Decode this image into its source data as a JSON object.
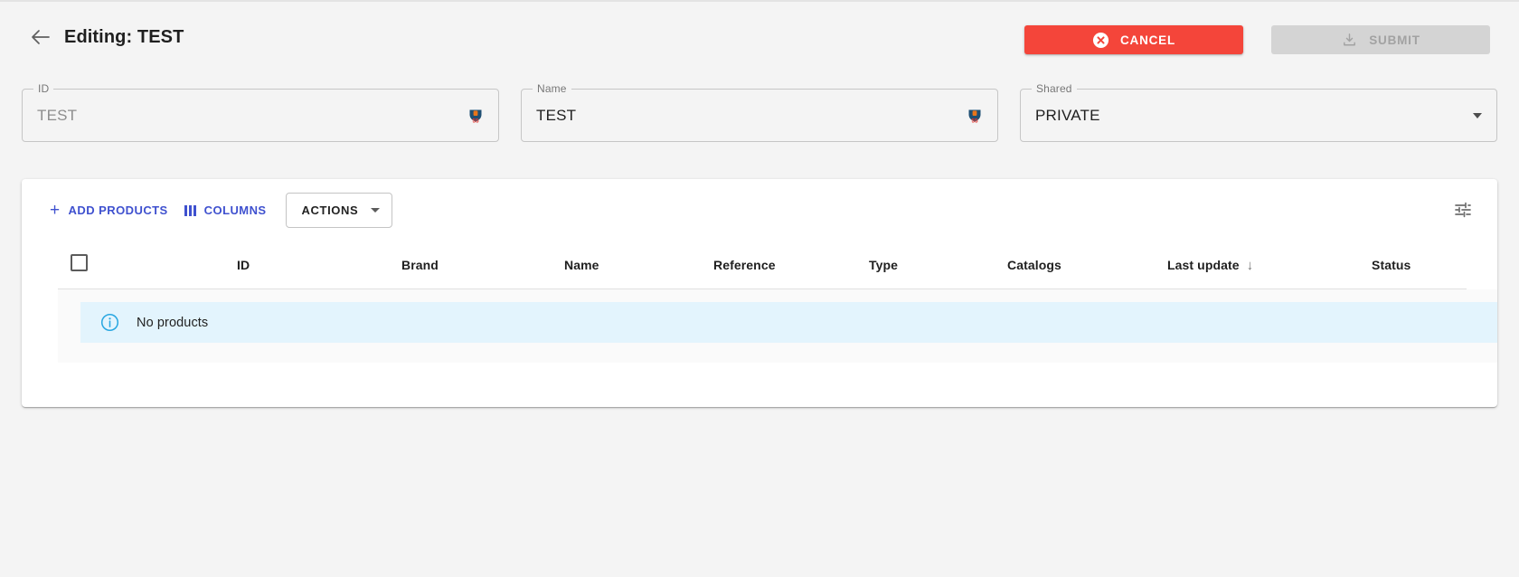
{
  "header": {
    "back_icon": "arrow-left-icon",
    "title": "Editing: TEST",
    "cancel_label": "CANCEL",
    "cancel_icon": "cancel-circle-icon",
    "cancel_color": "#f4453a",
    "submit_label": "SUBMIT",
    "submit_icon": "save-download-icon",
    "submit_disabled_color": "#d4d4d4"
  },
  "form": {
    "fields": [
      {
        "legend": "ID",
        "value": "TEST",
        "placeholder": "TEST",
        "muted": true,
        "trailing_icon": "password-manager-badge-icon"
      },
      {
        "legend": "Name",
        "value": "TEST",
        "placeholder": "Name",
        "muted": false,
        "trailing_icon": "password-manager-badge-icon"
      },
      {
        "legend": "Shared",
        "value": "PRIVATE",
        "placeholder": "Shared",
        "muted": false,
        "trailing_icon": "chevron-down-icon"
      }
    ]
  },
  "toolbar": {
    "add_products_label": "ADD PRODUCTS",
    "add_products_icon": "plus-icon",
    "columns_label": "COLUMNS",
    "columns_icon": "columns-icon",
    "actions_label": "ACTIONS",
    "actions_icon": "chevron-down-icon",
    "tune_icon": "tune-settings-icon",
    "link_color": "#3f51cf"
  },
  "table": {
    "select_all_checkbox": "unchecked",
    "columns": [
      {
        "label": "ID",
        "sorted": false
      },
      {
        "label": "Brand",
        "sorted": false
      },
      {
        "label": "Name",
        "sorted": false
      },
      {
        "label": "Reference",
        "sorted": false
      },
      {
        "label": "Type",
        "sorted": false
      },
      {
        "label": "Catalogs",
        "sorted": false
      },
      {
        "label": "Last update",
        "sorted": true,
        "sort_arrow": "↓"
      },
      {
        "label": "Status",
        "sorted": false
      }
    ],
    "rows": [],
    "empty_state": {
      "icon": "info-circle-icon",
      "message": "No products",
      "background_color": "#e3f4fd"
    }
  }
}
